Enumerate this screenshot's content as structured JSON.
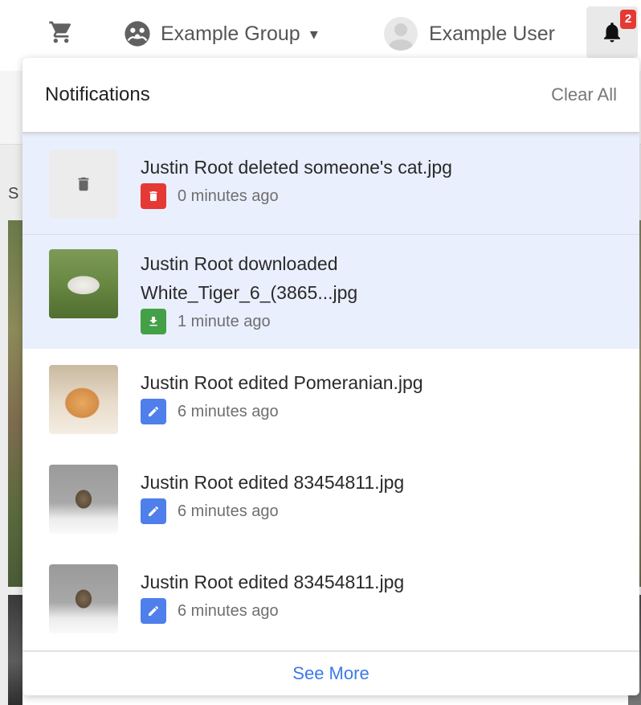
{
  "navbar": {
    "cart_icon": "cart-icon",
    "group": {
      "icon": "group-icon",
      "label": "Example Group",
      "caret": "▾"
    },
    "user": {
      "label": "Example User",
      "avatar_icon": "user-avatar-icon"
    },
    "bell": {
      "icon": "bell-icon",
      "badge_count": "2"
    }
  },
  "background": {
    "letter": "S"
  },
  "notifications": {
    "title": "Notifications",
    "clear_all": "Clear All",
    "see_more": "See More",
    "colors": {
      "unread_bg": "#e9effd",
      "delete": "#e53935",
      "download": "#43a047",
      "edit": "#4f7fea",
      "link": "#3b7ae6"
    },
    "items": [
      {
        "text": "Justin Root deleted someone's cat.jpg",
        "time": "0 minutes ago",
        "type": "delete",
        "type_icon": "trash-icon",
        "thumb": "trash-placeholder",
        "unread": true
      },
      {
        "text": "Justin Root downloaded White_Tiger_6_(3865...jpg",
        "time": "1 minute ago",
        "type": "download",
        "type_icon": "download-icon",
        "thumb": "white-tiger-photo",
        "unread": true
      },
      {
        "text": "Justin Root edited Pomeranian.jpg",
        "time": "6 minutes ago",
        "type": "edit",
        "type_icon": "pencil-icon",
        "thumb": "pomeranian-photo",
        "unread": false
      },
      {
        "text": "Justin Root edited 83454811.jpg",
        "time": "6 minutes ago",
        "type": "edit",
        "type_icon": "pencil-icon",
        "thumb": "kitten-photo",
        "unread": false
      },
      {
        "text": "Justin Root edited 83454811.jpg",
        "time": "6 minutes ago",
        "type": "edit",
        "type_icon": "pencil-icon",
        "thumb": "kitten-photo",
        "unread": false
      }
    ]
  }
}
